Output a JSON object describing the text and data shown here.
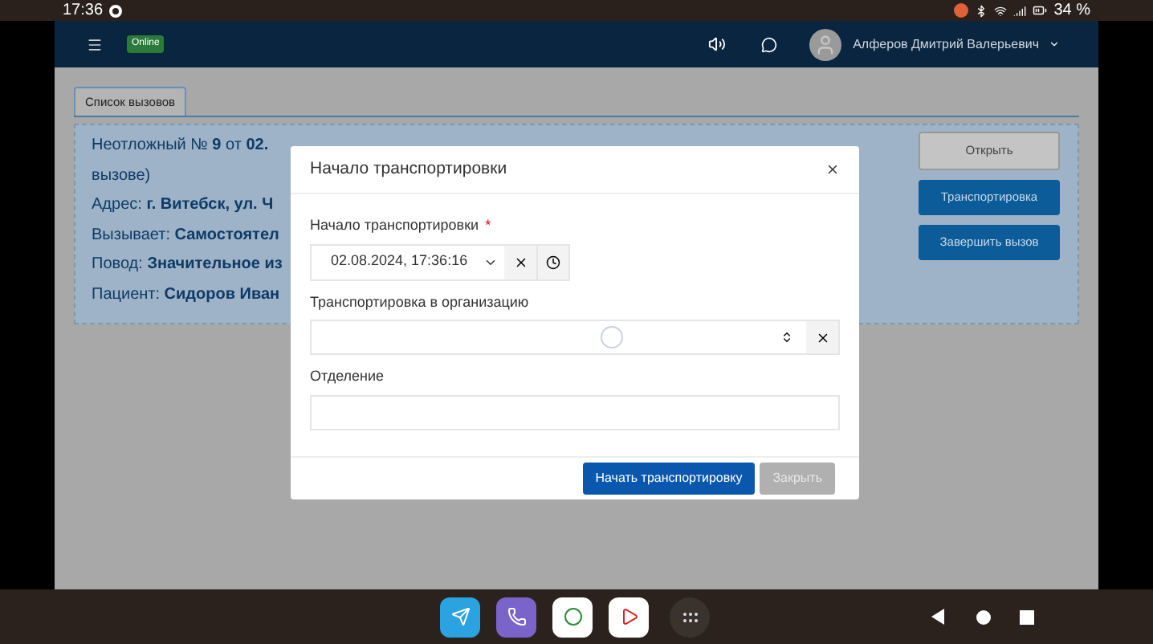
{
  "status_bar": {
    "time": "17:36",
    "battery": "34 %"
  },
  "header": {
    "badge": "Online",
    "user": "Алферов Дмитрий Валерьевич"
  },
  "tabs": [
    {
      "label": "Список вызовов",
      "selected": true
    }
  ],
  "call_card": {
    "lines": [
      {
        "label": "Неотложный № **9** от **02.**"
      },
      {
        "label": "вызове)"
      },
      {
        "label": "Адрес: **г. Витебск, ул. Ч**"
      },
      {
        "label": "Вызывает: **Самостоятел**"
      },
      {
        "label": "Повод: **Значительное из**"
      },
      {
        "label": "Пациент: **Сидоров Иван**"
      }
    ],
    "buttons": [
      {
        "label": "Открыть",
        "kind": "secondary"
      },
      {
        "label": "Транспортировка",
        "kind": "primary"
      },
      {
        "label": "Завершить вызов",
        "kind": "primary"
      }
    ]
  },
  "modal": {
    "title": "Начало транспортировки",
    "fields": [
      {
        "label": "Начало транспортировки",
        "required_mark": "*",
        "kind": "datetime",
        "value": "02.08.2024, 17:36:16"
      },
      {
        "label": "Транспортировка в организацию",
        "kind": "select",
        "loading": true
      },
      {
        "label": "Отделение",
        "kind": "text"
      }
    ],
    "buttons": [
      {
        "label": "Начать транспортировку",
        "disabled": false
      },
      {
        "label": "Закрыть",
        "disabled": true
      }
    ]
  }
}
